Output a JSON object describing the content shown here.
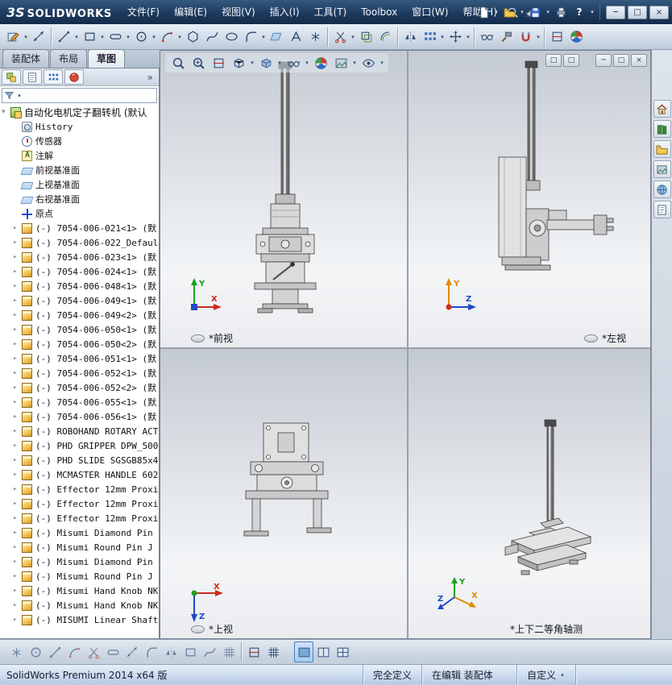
{
  "window": {
    "brand_prefix": "3S",
    "brand": "SOLIDWORKS",
    "menus": [
      "文件(F)",
      "编辑(E)",
      "视图(V)",
      "插入(I)",
      "工具(T)",
      "Toolbox",
      "窗口(W)",
      "帮助(H)"
    ]
  },
  "glyphs": {
    "dropdown": "▾",
    "minimize": "─",
    "restore": "□",
    "close": "×",
    "chevron_double": "»",
    "tree_collapsed": "▸",
    "tree_expanded": "▾",
    "help": "?"
  },
  "command_tabs": [
    {
      "label": "装配体",
      "active": false
    },
    {
      "label": "布局",
      "active": false
    },
    {
      "label": "草图",
      "active": true
    }
  ],
  "feature_tree": {
    "root_label": "自动化电机定子翻转机 (默认",
    "items": [
      {
        "icon": "history",
        "expand": false,
        "label": "History"
      },
      {
        "icon": "sensor",
        "expand": false,
        "label": "传感器"
      },
      {
        "icon": "annotation",
        "expand": false,
        "label": "注解"
      },
      {
        "icon": "plane",
        "expand": false,
        "label": "前视基准面"
      },
      {
        "icon": "plane",
        "expand": false,
        "label": "上视基准面"
      },
      {
        "icon": "plane",
        "expand": false,
        "label": "右视基准面"
      },
      {
        "icon": "origin",
        "expand": false,
        "label": "原点"
      },
      {
        "icon": "part",
        "expand": true,
        "label": "(-) 7054-006-021<1> (默"
      },
      {
        "icon": "part",
        "expand": true,
        "label": "(-) 7054-006-022_Defaul"
      },
      {
        "icon": "part",
        "expand": true,
        "label": "(-) 7054-006-023<1> (默"
      },
      {
        "icon": "part",
        "expand": true,
        "label": "(-) 7054-006-024<1> (默"
      },
      {
        "icon": "part",
        "expand": true,
        "label": "(-) 7054-006-048<1> (默"
      },
      {
        "icon": "part",
        "expand": true,
        "label": "(-) 7054-006-049<1> (默"
      },
      {
        "icon": "part",
        "expand": true,
        "label": "(-) 7054-006-049<2> (默"
      },
      {
        "icon": "part",
        "expand": true,
        "label": "(-) 7054-006-050<1> (默"
      },
      {
        "icon": "part",
        "expand": true,
        "label": "(-) 7054-006-050<2> (默"
      },
      {
        "icon": "part",
        "expand": true,
        "label": "(-) 7054-006-051<1> (默"
      },
      {
        "icon": "part",
        "expand": true,
        "label": "(-) 7054-006-052<1> (默"
      },
      {
        "icon": "part",
        "expand": true,
        "label": "(-) 7054-006-052<2> (默"
      },
      {
        "icon": "part",
        "expand": true,
        "label": "(-) 7054-006-055<1> (默"
      },
      {
        "icon": "part",
        "expand": true,
        "label": "(-) 7054-006-056<1> (默"
      },
      {
        "icon": "part",
        "expand": true,
        "label": "(-) ROBOHAND ROTARY ACT"
      },
      {
        "icon": "part",
        "expand": true,
        "label": "(-) PHD GRIPPER DPW_500"
      },
      {
        "icon": "part",
        "expand": true,
        "label": "(-) PHD SLIDE SGSGB85x4"
      },
      {
        "icon": "part",
        "expand": true,
        "label": "(-) MCMASTER HANDLE 602"
      },
      {
        "icon": "part",
        "expand": true,
        "label": "(-) Effector 12mm Proxi"
      },
      {
        "icon": "part",
        "expand": true,
        "label": "(-) Effector 12mm Proxi"
      },
      {
        "icon": "part",
        "expand": true,
        "label": "(-) Effector 12mm Proxi"
      },
      {
        "icon": "part",
        "expand": true,
        "label": "(-) Misumi Diamond Pin"
      },
      {
        "icon": "part",
        "expand": true,
        "label": "(-) Misumi  Round Pin J"
      },
      {
        "icon": "part",
        "expand": true,
        "label": "(-) Misumi Diamond Pin"
      },
      {
        "icon": "part",
        "expand": true,
        "label": "(-) Misumi  Round Pin J"
      },
      {
        "icon": "part",
        "expand": true,
        "label": "(-) Misumi Hand Knob NK"
      },
      {
        "icon": "part",
        "expand": true,
        "label": "(-) Misumi Hand Knob NK"
      },
      {
        "icon": "part",
        "expand": true,
        "label": "(-) MISUMI Linear Shaft"
      }
    ]
  },
  "viewports": [
    {
      "label": "*前视"
    },
    {
      "label": "*左视"
    },
    {
      "label": "*上视"
    },
    {
      "label": "*上下二等角轴测"
    }
  ],
  "triad": {
    "x": "X",
    "y": "Y",
    "z": "Z"
  },
  "status_bar": {
    "app_version": "SolidWorks Premium 2014 x64 版",
    "definition_state": "完全定义",
    "edit_mode": "在编辑 装配体",
    "toolbar_preset": "自定义"
  },
  "colors": {
    "axis_x": "#cc2a1e",
    "axis_y": "#1fa01f",
    "axis_z": "#2048c8",
    "axis_alt": "#e08a00",
    "active_view_highlight": "#4a7ec2",
    "titlebar": "#1d3a5e"
  }
}
